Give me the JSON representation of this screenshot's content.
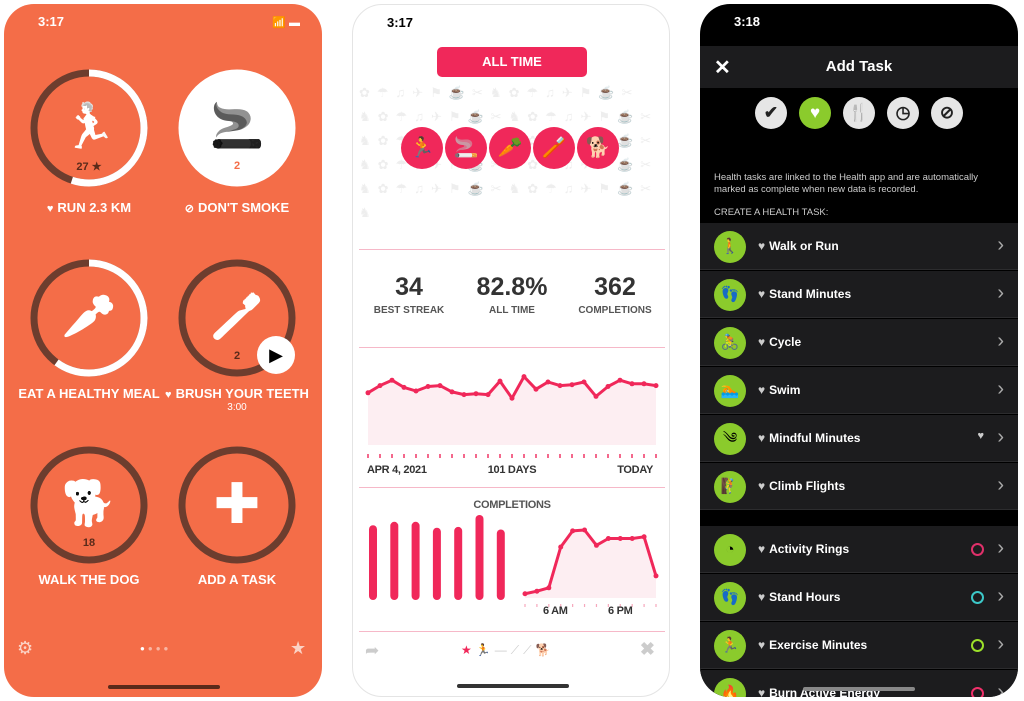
{
  "phone1": {
    "time": "3:17",
    "tasks": [
      {
        "label": "RUN 2.3 KM",
        "prefix_icon": "heart-icon",
        "icon": "runner-icon",
        "glyph": "🏃",
        "count": "27 ★",
        "progress": 0.55,
        "filled": false
      },
      {
        "label": "DON'T SMOKE",
        "prefix_icon": "no-icon",
        "icon": "cigarette-icon",
        "glyph": "🚬",
        "count": "2",
        "progress": 1,
        "filled": true
      },
      {
        "label": "EAT A HEALTHY MEAL",
        "icon": "carrot-icon",
        "glyph": "🥕",
        "count": "",
        "progress": 0.6,
        "filled": false
      },
      {
        "label": "BRUSH YOUR TEETH",
        "prefix_icon": "heart-icon",
        "icon": "toothbrush-icon",
        "glyph": "🪥",
        "count": "2",
        "sub": "3:00",
        "progress": 0,
        "filled": false
      },
      {
        "label": "WALK THE DOG",
        "icon": "dog-icon",
        "glyph": "🐕",
        "count": "18",
        "progress": 0,
        "filled": false
      },
      {
        "label": "ADD A TASK",
        "icon": "plus-icon",
        "glyph": "✚",
        "count": "",
        "progress": 0,
        "filled": false
      }
    ],
    "page_index": 1,
    "page_count": 4
  },
  "phone2": {
    "time": "3:17",
    "range_button": "ALL TIME",
    "task_icons": [
      "🏃",
      "🚬",
      "🥕",
      "🪥",
      "🐕"
    ],
    "stats": [
      {
        "value": "34",
        "label": "BEST STREAK"
      },
      {
        "value": "82.8%",
        "label": "ALL TIME"
      },
      {
        "value": "362",
        "label": "COMPLETIONS"
      }
    ],
    "history": {
      "start": "APR 4, 2021",
      "span": "101 DAYS",
      "end": "TODAY",
      "values": [
        58,
        66,
        72,
        64,
        60,
        65,
        66,
        59,
        56,
        57,
        56,
        71,
        52,
        76,
        62,
        70,
        66,
        67,
        70,
        54,
        65,
        72,
        68,
        68,
        66
      ]
    },
    "completions": {
      "title": "COMPLETIONS",
      "weekday_values": [
        88,
        92,
        92,
        85,
        86,
        100,
        83
      ],
      "hourly_values": [
        5,
        8,
        12,
        60,
        79,
        80,
        62,
        70,
        70,
        70,
        72,
        26
      ],
      "hour_labels": [
        "6 AM",
        "6 PM"
      ]
    },
    "accent": "#f0285a"
  },
  "phone3": {
    "time": "3:18",
    "title": "Add Task",
    "categories": [
      {
        "name": "check",
        "glyph": "✔"
      },
      {
        "name": "heart",
        "glyph": "♥",
        "selected": true
      },
      {
        "name": "fork-knife",
        "glyph": "🍴"
      },
      {
        "name": "clock",
        "glyph": "◷"
      },
      {
        "name": "no",
        "glyph": "⊘"
      }
    ],
    "description": "Health tasks are linked to the Health app and are automatically marked as complete when new data is recorded.",
    "section": "CREATE A HEALTH TASK:",
    "tasks": [
      {
        "label": "Walk or Run",
        "glyph": "🚶"
      },
      {
        "label": "Stand Minutes",
        "glyph": "👣"
      },
      {
        "label": "Cycle",
        "glyph": "🚴"
      },
      {
        "label": "Swim",
        "glyph": "🏊"
      },
      {
        "label": "Mindful Minutes",
        "glyph": "༄",
        "extra": "♥"
      },
      {
        "label": "Climb Flights",
        "glyph": "🧗"
      }
    ],
    "tasks2": [
      {
        "label": "Activity Rings",
        "glyph": "◔",
        "ring": "#e0306a"
      },
      {
        "label": "Stand Hours",
        "glyph": "👣",
        "ring": "#3cc8c8"
      },
      {
        "label": "Exercise Minutes",
        "glyph": "🏃",
        "ring": "#9ce02a"
      },
      {
        "label": "Burn Active Energy",
        "glyph": "🔥",
        "ring": "#f0306a"
      }
    ],
    "accent": "#8bcb2c"
  }
}
